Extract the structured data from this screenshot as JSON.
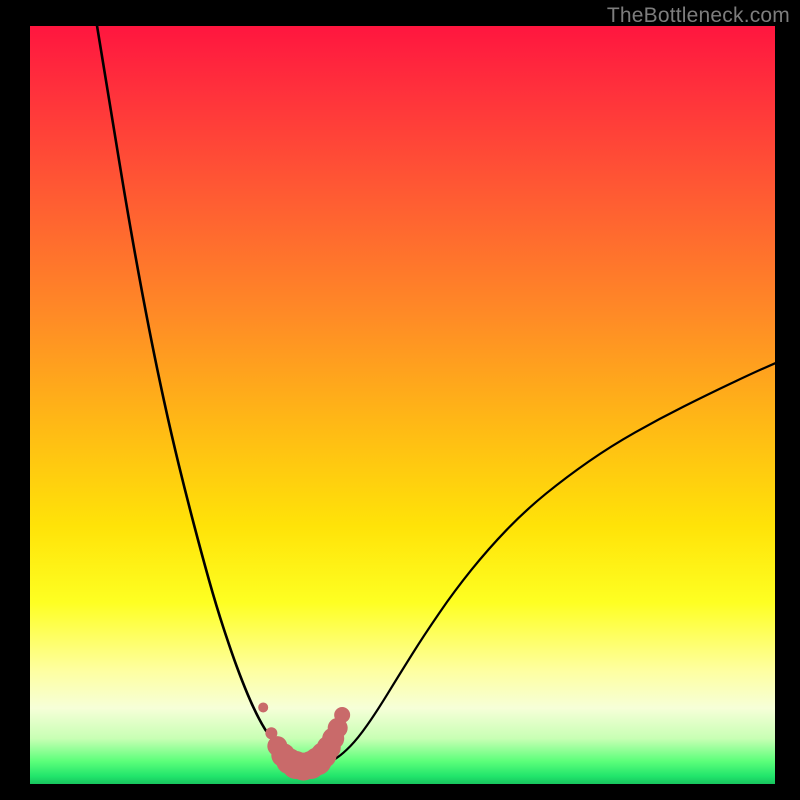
{
  "watermark": "TheBottleneck.com",
  "colors": {
    "background_frame": "#000000",
    "gradient_top": "#ff163f",
    "gradient_bottom": "#18c45e",
    "curve_stroke": "#000000",
    "marker_stroke": "#c96a6a",
    "marker_fill": "#c96a6a"
  },
  "chart_data": {
    "type": "line",
    "title": "",
    "xlabel": "",
    "ylabel": "",
    "xlim": [
      0,
      100
    ],
    "ylim": [
      0,
      100
    ],
    "series": [
      {
        "name": "left-curve",
        "x": [
          9.0,
          11,
          13,
          15,
          17,
          19,
          21,
          23,
          25,
          27,
          28.5,
          30,
          31.5,
          33,
          34.5,
          35.5
        ],
        "y": [
          100,
          88,
          76,
          65,
          55,
          46,
          38,
          30.5,
          23.5,
          17.5,
          13.5,
          10,
          7.2,
          5.2,
          3.7,
          3.0
        ]
      },
      {
        "name": "right-curve",
        "x": [
          40.5,
          42,
          44,
          46.5,
          49.5,
          53,
          57,
          61.5,
          66.5,
          72,
          78,
          84.5,
          91,
          97,
          100
        ],
        "y": [
          3.0,
          4.0,
          6.0,
          9.5,
          14.3,
          19.8,
          25.5,
          31.0,
          36.1,
          40.5,
          44.6,
          48.2,
          51.4,
          54.2,
          55.5
        ]
      },
      {
        "name": "valley-markers",
        "x": [
          32.4,
          33.2,
          34.0,
          34.8,
          35.7,
          36.7,
          37.7,
          38.6,
          39.4,
          40.1,
          40.7,
          41.3,
          41.9
        ],
        "y": [
          6.7,
          5.0,
          3.8,
          3.0,
          2.5,
          2.3,
          2.5,
          3.0,
          3.8,
          4.8,
          6.0,
          7.4,
          9.1
        ],
        "marker_sizes": [
          6,
          10,
          12,
          13,
          14,
          14,
          14,
          14,
          13,
          12,
          11,
          10,
          8
        ]
      }
    ]
  }
}
